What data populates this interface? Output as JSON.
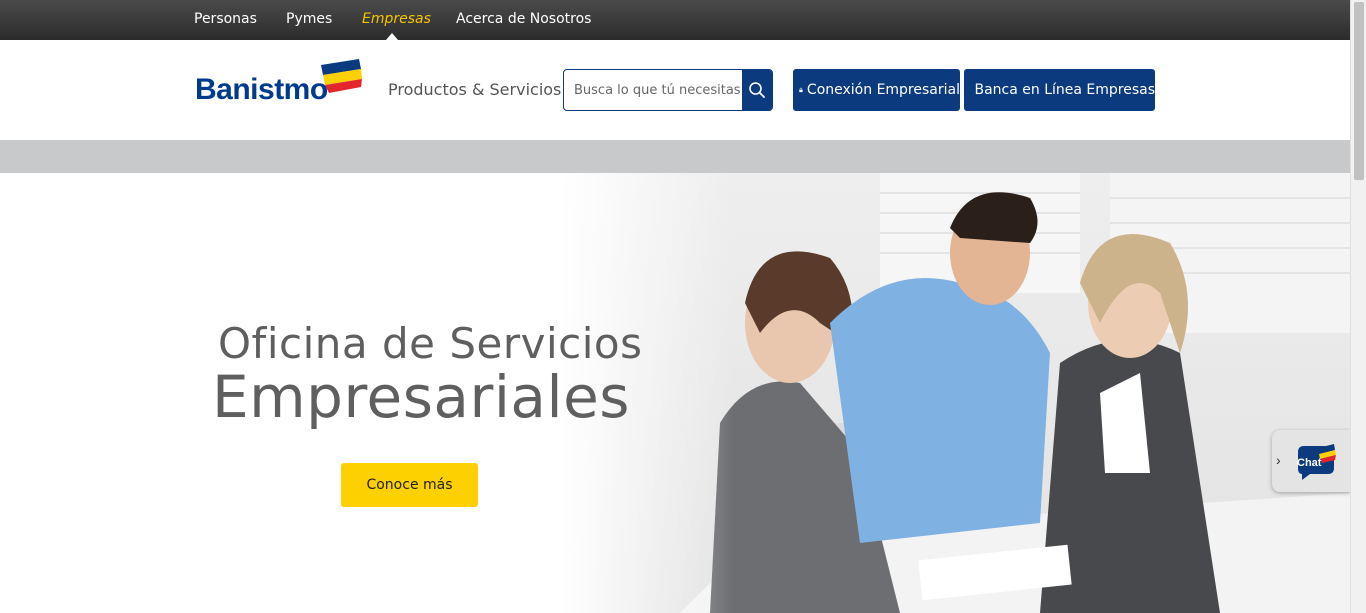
{
  "topnav": {
    "items": [
      {
        "label": "Personas"
      },
      {
        "label": "Pymes"
      },
      {
        "label": "Empresas",
        "active": true
      },
      {
        "label": "Acerca de Nosotros"
      }
    ]
  },
  "header": {
    "logo_text": "Banistmo",
    "products_label": "Productos & Servicios",
    "search": {
      "placeholder": "Busca lo que tú necesitas",
      "value": ""
    },
    "buttons": [
      {
        "label": "Conexión Empresarial",
        "icon": "lock-icon"
      },
      {
        "label": "Banca en Línea Empresas",
        "icon": "lock-icon"
      }
    ]
  },
  "hero": {
    "title_line1": "Oficina de Servicios",
    "title_line2": "Empresariales",
    "cta_label": "Conoce más"
  },
  "chat": {
    "label": "Chat"
  },
  "colors": {
    "brand_blue": "#0b3a7e",
    "active_nav": "#f5c400",
    "cta_yellow": "#fdd000",
    "grey_band": "#c8c9cb"
  }
}
